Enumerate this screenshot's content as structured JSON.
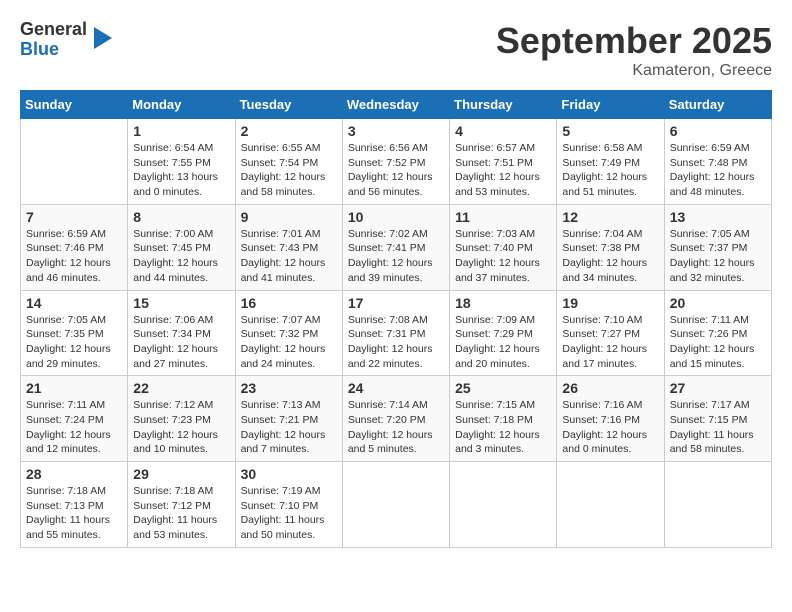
{
  "logo": {
    "line1": "General",
    "line2": "Blue"
  },
  "title": "September 2025",
  "location": "Kamateron, Greece",
  "weekdays": [
    "Sunday",
    "Monday",
    "Tuesday",
    "Wednesday",
    "Thursday",
    "Friday",
    "Saturday"
  ],
  "weeks": [
    [
      {
        "day": "",
        "info": ""
      },
      {
        "day": "1",
        "info": "Sunrise: 6:54 AM\nSunset: 7:55 PM\nDaylight: 13 hours\nand 0 minutes."
      },
      {
        "day": "2",
        "info": "Sunrise: 6:55 AM\nSunset: 7:54 PM\nDaylight: 12 hours\nand 58 minutes."
      },
      {
        "day": "3",
        "info": "Sunrise: 6:56 AM\nSunset: 7:52 PM\nDaylight: 12 hours\nand 56 minutes."
      },
      {
        "day": "4",
        "info": "Sunrise: 6:57 AM\nSunset: 7:51 PM\nDaylight: 12 hours\nand 53 minutes."
      },
      {
        "day": "5",
        "info": "Sunrise: 6:58 AM\nSunset: 7:49 PM\nDaylight: 12 hours\nand 51 minutes."
      },
      {
        "day": "6",
        "info": "Sunrise: 6:59 AM\nSunset: 7:48 PM\nDaylight: 12 hours\nand 48 minutes."
      }
    ],
    [
      {
        "day": "7",
        "info": "Sunrise: 6:59 AM\nSunset: 7:46 PM\nDaylight: 12 hours\nand 46 minutes."
      },
      {
        "day": "8",
        "info": "Sunrise: 7:00 AM\nSunset: 7:45 PM\nDaylight: 12 hours\nand 44 minutes."
      },
      {
        "day": "9",
        "info": "Sunrise: 7:01 AM\nSunset: 7:43 PM\nDaylight: 12 hours\nand 41 minutes."
      },
      {
        "day": "10",
        "info": "Sunrise: 7:02 AM\nSunset: 7:41 PM\nDaylight: 12 hours\nand 39 minutes."
      },
      {
        "day": "11",
        "info": "Sunrise: 7:03 AM\nSunset: 7:40 PM\nDaylight: 12 hours\nand 37 minutes."
      },
      {
        "day": "12",
        "info": "Sunrise: 7:04 AM\nSunset: 7:38 PM\nDaylight: 12 hours\nand 34 minutes."
      },
      {
        "day": "13",
        "info": "Sunrise: 7:05 AM\nSunset: 7:37 PM\nDaylight: 12 hours\nand 32 minutes."
      }
    ],
    [
      {
        "day": "14",
        "info": "Sunrise: 7:05 AM\nSunset: 7:35 PM\nDaylight: 12 hours\nand 29 minutes."
      },
      {
        "day": "15",
        "info": "Sunrise: 7:06 AM\nSunset: 7:34 PM\nDaylight: 12 hours\nand 27 minutes."
      },
      {
        "day": "16",
        "info": "Sunrise: 7:07 AM\nSunset: 7:32 PM\nDaylight: 12 hours\nand 24 minutes."
      },
      {
        "day": "17",
        "info": "Sunrise: 7:08 AM\nSunset: 7:31 PM\nDaylight: 12 hours\nand 22 minutes."
      },
      {
        "day": "18",
        "info": "Sunrise: 7:09 AM\nSunset: 7:29 PM\nDaylight: 12 hours\nand 20 minutes."
      },
      {
        "day": "19",
        "info": "Sunrise: 7:10 AM\nSunset: 7:27 PM\nDaylight: 12 hours\nand 17 minutes."
      },
      {
        "day": "20",
        "info": "Sunrise: 7:11 AM\nSunset: 7:26 PM\nDaylight: 12 hours\nand 15 minutes."
      }
    ],
    [
      {
        "day": "21",
        "info": "Sunrise: 7:11 AM\nSunset: 7:24 PM\nDaylight: 12 hours\nand 12 minutes."
      },
      {
        "day": "22",
        "info": "Sunrise: 7:12 AM\nSunset: 7:23 PM\nDaylight: 12 hours\nand 10 minutes."
      },
      {
        "day": "23",
        "info": "Sunrise: 7:13 AM\nSunset: 7:21 PM\nDaylight: 12 hours\nand 7 minutes."
      },
      {
        "day": "24",
        "info": "Sunrise: 7:14 AM\nSunset: 7:20 PM\nDaylight: 12 hours\nand 5 minutes."
      },
      {
        "day": "25",
        "info": "Sunrise: 7:15 AM\nSunset: 7:18 PM\nDaylight: 12 hours\nand 3 minutes."
      },
      {
        "day": "26",
        "info": "Sunrise: 7:16 AM\nSunset: 7:16 PM\nDaylight: 12 hours\nand 0 minutes."
      },
      {
        "day": "27",
        "info": "Sunrise: 7:17 AM\nSunset: 7:15 PM\nDaylight: 11 hours\nand 58 minutes."
      }
    ],
    [
      {
        "day": "28",
        "info": "Sunrise: 7:18 AM\nSunset: 7:13 PM\nDaylight: 11 hours\nand 55 minutes."
      },
      {
        "day": "29",
        "info": "Sunrise: 7:18 AM\nSunset: 7:12 PM\nDaylight: 11 hours\nand 53 minutes."
      },
      {
        "day": "30",
        "info": "Sunrise: 7:19 AM\nSunset: 7:10 PM\nDaylight: 11 hours\nand 50 minutes."
      },
      {
        "day": "",
        "info": ""
      },
      {
        "day": "",
        "info": ""
      },
      {
        "day": "",
        "info": ""
      },
      {
        "day": "",
        "info": ""
      }
    ]
  ]
}
